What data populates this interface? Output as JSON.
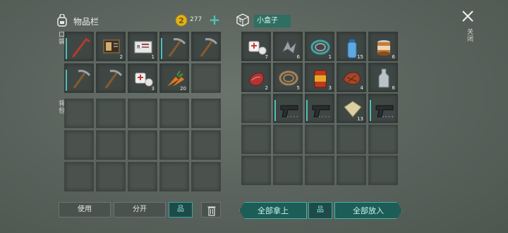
{
  "inventory": {
    "title": "物品栏",
    "coins": "277",
    "plus_label": "+",
    "pocket_label": "口袋",
    "backpack_label": "背包"
  },
  "pocket_slots": [
    {
      "name": "crowbar",
      "qty": "",
      "dur": true
    },
    {
      "name": "notebook",
      "qty": "2",
      "dur": false
    },
    {
      "name": "id-card",
      "qty": "1",
      "dur": false
    },
    {
      "name": "pickaxe",
      "qty": "",
      "dur": true
    },
    {
      "name": "pickaxe",
      "qty": "",
      "dur": false
    },
    {
      "name": "pickaxe",
      "qty": "",
      "dur": true
    },
    {
      "name": "pickaxe",
      "qty": "",
      "dur": false
    },
    {
      "name": "bandage",
      "qty": "3",
      "dur": false
    },
    {
      "name": "carrot",
      "qty": "20",
      "dur": false
    },
    {
      "name": "empty",
      "qty": "",
      "dur": false
    }
  ],
  "buttons": {
    "use": "使用",
    "split": "分开",
    "sort_icon": "品",
    "trash_icon": "trash-icon"
  },
  "container": {
    "name": "小盒子",
    "close_label": "关闭",
    "take_all": "全部拿上",
    "sort_icon": "品",
    "put_all": "全部放入"
  },
  "container_slots": [
    {
      "name": "bandage",
      "qty": "7"
    },
    {
      "name": "scrap-metal",
      "qty": "6"
    },
    {
      "name": "rope-coil",
      "qty": "1"
    },
    {
      "name": "water-bottle",
      "qty": "15"
    },
    {
      "name": "can",
      "qty": "6"
    },
    {
      "name": "raw-meat",
      "qty": "2"
    },
    {
      "name": "rope",
      "qty": "5"
    },
    {
      "name": "canned-food",
      "qty": "3"
    },
    {
      "name": "steak",
      "qty": "4"
    },
    {
      "name": "bottle",
      "qty": "6"
    },
    {
      "name": "empty",
      "qty": ""
    },
    {
      "name": "pistol",
      "qty": "",
      "dots": "grey"
    },
    {
      "name": "pistol",
      "qty": "",
      "dots": "grey"
    },
    {
      "name": "cloth",
      "qty": "13"
    },
    {
      "name": "pistol",
      "qty": "",
      "dots": "purple"
    }
  ],
  "colors": {
    "accent": "#42b3a6",
    "container_tag": "#2e6f62"
  }
}
